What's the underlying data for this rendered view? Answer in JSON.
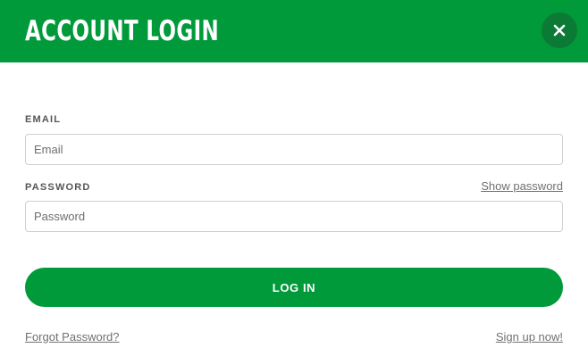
{
  "header": {
    "title": "ACCOUNT LOGIN",
    "close_icon": "close-icon"
  },
  "form": {
    "email_label": "EMAIL",
    "email_placeholder": "Email",
    "email_value": "",
    "password_label": "PASSWORD",
    "password_placeholder": "Password",
    "password_value": "",
    "show_password_label": "Show password",
    "login_button_label": "LOG IN"
  },
  "footer": {
    "forgot_password_label": "Forgot Password?",
    "signup_label": "Sign up now!"
  },
  "colors": {
    "brand_green": "#009a3b",
    "close_button_bg": "#0b7a35"
  }
}
